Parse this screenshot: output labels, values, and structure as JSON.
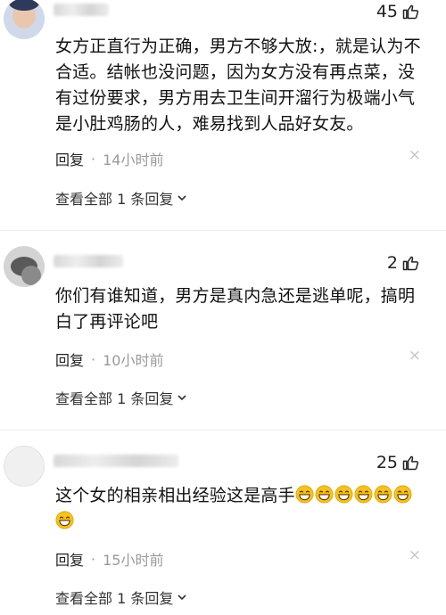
{
  "comments": [
    {
      "likes": "45",
      "lines": [
        "女方正直行为正确，男方不够大放:，就是认为不",
        "合适。结帐也没问题，因为女方没有再点菜，没",
        "有过份要求，男方用去卫生间开溜行为极端小气",
        "是小肚鸡肠的人，难易找到人品好女友。"
      ],
      "reply_label": "回复",
      "dot": "·",
      "time": "14小时前",
      "close": "×",
      "view_replies": "查看全部 1 条回复"
    },
    {
      "likes": "2",
      "lines": [
        "你们有谁知道，男方是真内急还是逃单呢，搞明",
        "白了再评论吧"
      ],
      "reply_label": "回复",
      "dot": "·",
      "time": "10小时前",
      "close": "×",
      "view_replies": "查看全部 1 条回复"
    },
    {
      "likes": "25",
      "lines": [
        "这个女的相亲相出经验这是高手"
      ],
      "emoji_count": 7,
      "emoji_name": "grinning-emoji",
      "reply_label": "回复",
      "dot": "·",
      "time": "15小时前",
      "close": "×",
      "view_replies": "查看全部 1 条回复"
    }
  ],
  "colors": {
    "text": "#111111",
    "meta": "#9a9a9a",
    "emoji": "#f6c21c"
  }
}
